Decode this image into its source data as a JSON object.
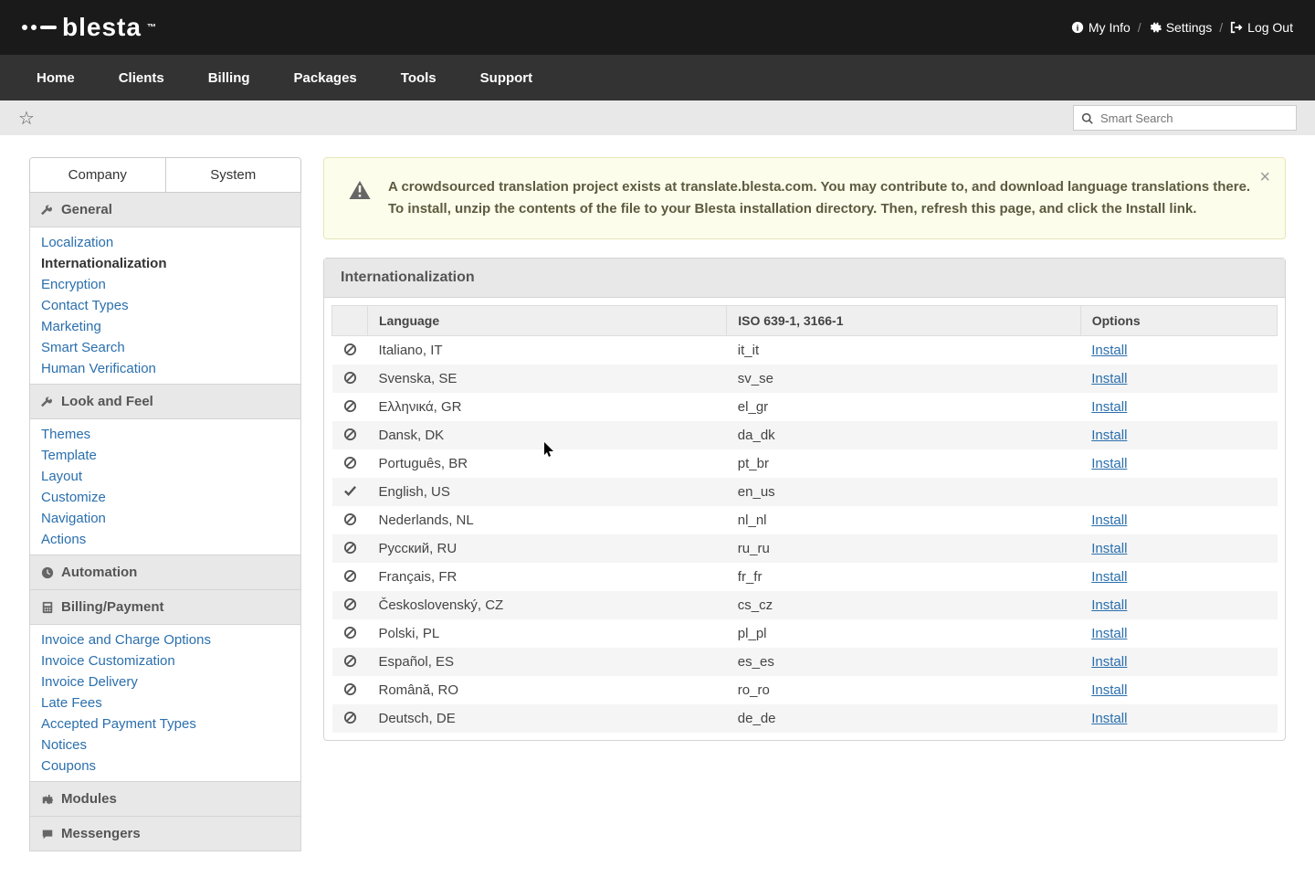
{
  "top": {
    "myinfo": "My Info",
    "settings": "Settings",
    "logout": "Log Out",
    "logo": "blesta"
  },
  "nav": [
    "Home",
    "Clients",
    "Billing",
    "Packages",
    "Tools",
    "Support"
  ],
  "search": {
    "placeholder": "Smart Search"
  },
  "sidebarTabs": {
    "company": "Company",
    "system": "System"
  },
  "sections": {
    "general": {
      "title": "General",
      "links": [
        {
          "label": "Localization",
          "active": false
        },
        {
          "label": "Internationalization",
          "active": true
        },
        {
          "label": "Encryption",
          "active": false
        },
        {
          "label": "Contact Types",
          "active": false
        },
        {
          "label": "Marketing",
          "active": false
        },
        {
          "label": "Smart Search",
          "active": false
        },
        {
          "label": "Human Verification",
          "active": false
        }
      ]
    },
    "look": {
      "title": "Look and Feel",
      "links": [
        {
          "label": "Themes"
        },
        {
          "label": "Template"
        },
        {
          "label": "Layout"
        },
        {
          "label": "Customize"
        },
        {
          "label": "Navigation"
        },
        {
          "label": "Actions"
        }
      ]
    },
    "automation": {
      "title": "Automation"
    },
    "billing": {
      "title": "Billing/Payment",
      "links": [
        {
          "label": "Invoice and Charge Options"
        },
        {
          "label": "Invoice Customization"
        },
        {
          "label": "Invoice Delivery"
        },
        {
          "label": "Late Fees"
        },
        {
          "label": "Accepted Payment Types"
        },
        {
          "label": "Notices"
        },
        {
          "label": "Coupons"
        }
      ]
    },
    "modules": {
      "title": "Modules"
    },
    "messengers": {
      "title": "Messengers"
    }
  },
  "alert": {
    "text": "A crowdsourced translation project exists at translate.blesta.com. You may contribute to, and download language translations there. To install, unzip the contents of the file to your Blesta installation directory. Then, refresh this page, and click the Install link."
  },
  "panel": {
    "title": "Internationalization",
    "cols": {
      "lang": "Language",
      "iso": "ISO 639-1, 3166-1",
      "opt": "Options"
    },
    "installLabel": "Install",
    "rows": [
      {
        "name": "Italiano, IT",
        "code": "it_it",
        "installed": false
      },
      {
        "name": "Svenska, SE",
        "code": "sv_se",
        "installed": false
      },
      {
        "name": "Ελληνικά, GR",
        "code": "el_gr",
        "installed": false
      },
      {
        "name": "Dansk, DK",
        "code": "da_dk",
        "installed": false
      },
      {
        "name": "Português, BR",
        "code": "pt_br",
        "installed": false
      },
      {
        "name": "English, US",
        "code": "en_us",
        "installed": true
      },
      {
        "name": "Nederlands, NL",
        "code": "nl_nl",
        "installed": false
      },
      {
        "name": "Русский, RU",
        "code": "ru_ru",
        "installed": false
      },
      {
        "name": "Français, FR",
        "code": "fr_fr",
        "installed": false
      },
      {
        "name": "Československý, CZ",
        "code": "cs_cz",
        "installed": false
      },
      {
        "name": "Polski, PL",
        "code": "pl_pl",
        "installed": false
      },
      {
        "name": "Español, ES",
        "code": "es_es",
        "installed": false
      },
      {
        "name": "Română, RO",
        "code": "ro_ro",
        "installed": false
      },
      {
        "name": "Deutsch, DE",
        "code": "de_de",
        "installed": false
      }
    ]
  }
}
